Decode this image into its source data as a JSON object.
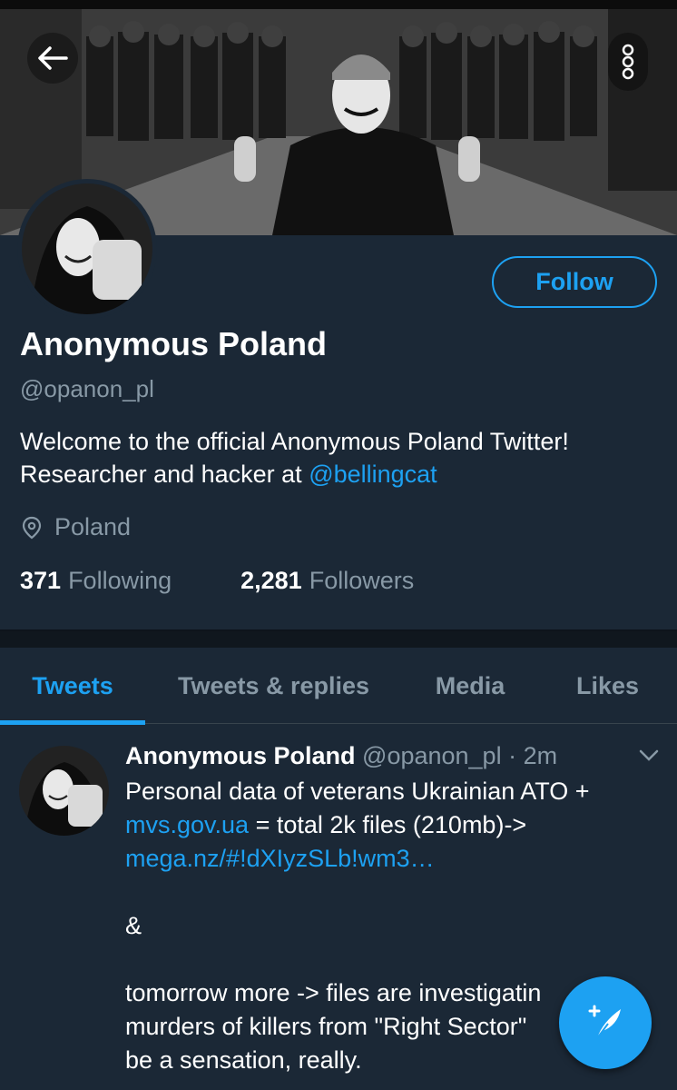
{
  "profile": {
    "display_name": "Anonymous Poland",
    "handle": "@opanon_pl",
    "bio_text": "Welcome to the official Anonymous Poland Twitter! Researcher and hacker at ",
    "bio_mention": "@bellingcat",
    "location": "Poland",
    "following_count": "371",
    "following_label": "Following",
    "followers_count": "2,281",
    "followers_label": "Followers",
    "follow_button": "Follow"
  },
  "tabs": [
    {
      "label": "Tweets",
      "active": true
    },
    {
      "label": "Tweets & replies",
      "active": false
    },
    {
      "label": "Media",
      "active": false
    },
    {
      "label": "Likes",
      "active": false
    }
  ],
  "tweet": {
    "author_name": "Anonymous Poland",
    "author_handle": "@opanon_pl",
    "separator": "·",
    "time": "2m",
    "line1": "Personal data of veterans Ukrainian ATO +",
    "link1": "mvs.gov.ua",
    "line2_rest": " = total 2k files (210mb)->",
    "link2": "mega.nz/#!dXIyzSLb!wm3…",
    "amp": "&",
    "line_more1": "tomorrow more -> files are investigatin",
    "line_more2": "murders of killers from \"Right Sector\"",
    "line_more3": "be a sensation, really."
  },
  "icons": {
    "back": "arrow-left-icon",
    "more": "vertical-dots-icon",
    "location": "location-pin-icon",
    "caret": "chevron-down-icon",
    "compose": "compose-feather-icon"
  },
  "colors": {
    "background": "#1b2836",
    "accent": "#1da1f2",
    "secondary_text": "#8899a6"
  }
}
